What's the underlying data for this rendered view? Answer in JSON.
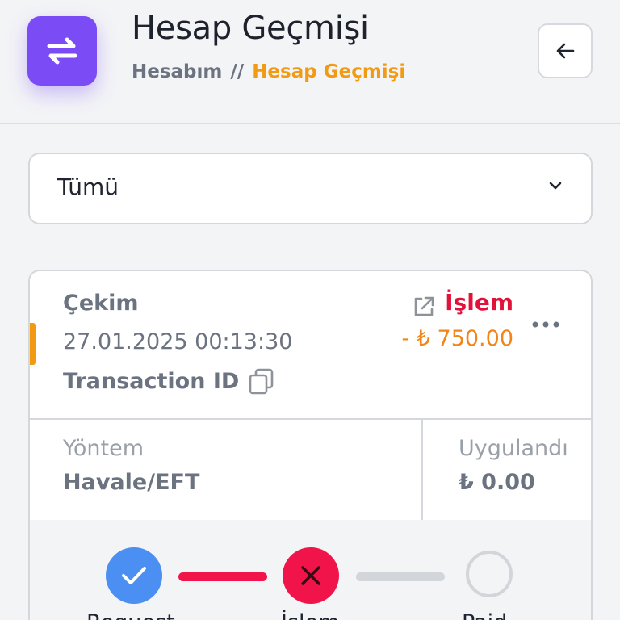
{
  "header": {
    "title": "Hesap Geçmişi",
    "breadcrumb": {
      "root": "Hesabım",
      "separator": "//",
      "current": "Hesap Geçmişi"
    },
    "app_icon": "swap-arrows-icon",
    "back_icon": "arrow-left-icon"
  },
  "filter": {
    "selected": "Tümü",
    "icon": "chevron-down-icon"
  },
  "transaction": {
    "type": "Çekim",
    "date": "27.01.2025 00:13:30",
    "id_label": "Transaction ID",
    "status": "İşlem",
    "amount": "- ₺ 750.00",
    "method_label": "Yöntem",
    "method_value": "Havale/EFT",
    "applied_label": "Uygulandı",
    "applied_value": "₺ 0.00",
    "steps": [
      {
        "label": "Request",
        "state": "done",
        "icon": "check-icon"
      },
      {
        "label": "İşlem",
        "state": "failed",
        "icon": "x-icon"
      },
      {
        "label": "Paid",
        "state": "pending",
        "icon": "empty-circle-icon"
      }
    ]
  },
  "colors": {
    "accent_purple": "#7b4cf5",
    "accent_orange": "#f29a14",
    "status_red": "#e3113a",
    "amount_orange": "#f28518",
    "step_done_blue": "#4b8ff2",
    "step_failed_red": "#f0144a"
  }
}
